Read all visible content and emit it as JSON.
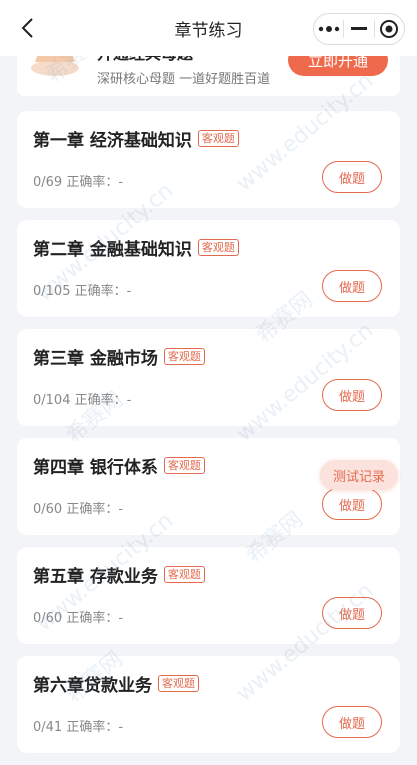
{
  "nav": {
    "title": "章节练习"
  },
  "banner": {
    "title": "开通经典母题",
    "subtitle": "深研核心母题 一道好题胜百道",
    "cta_label": "立即开通"
  },
  "chapters": [
    {
      "title": "第一章 经济基础知识",
      "tag": "客观题",
      "progress": "0/69",
      "accuracy": "正确率：-",
      "action": "做题"
    },
    {
      "title": "第二章 金融基础知识",
      "tag": "客观题",
      "progress": "0/105",
      "accuracy": "正确率：-",
      "action": "做题"
    },
    {
      "title": "第三章 金融市场",
      "tag": "客观题",
      "progress": "0/104",
      "accuracy": "正确率：-",
      "action": "做题"
    },
    {
      "title": "第四章 银行体系",
      "tag": "客观题",
      "progress": "0/60",
      "accuracy": "正确率：-",
      "action": "做题"
    },
    {
      "title": "第五章 存款业务",
      "tag": "客观题",
      "progress": "0/60",
      "accuracy": "正确率：-",
      "action": "做题"
    },
    {
      "title": "第六章贷款业务",
      "tag": "客观题",
      "progress": "0/41",
      "accuracy": "正确率：-",
      "action": "做题"
    }
  ],
  "floating": {
    "record_label": "测试记录"
  },
  "watermark": {
    "text": "www.educity.cn",
    "brand": "希赛网"
  },
  "colors": {
    "accent": "#e36a4f",
    "cta": "#ef6a4c"
  },
  "icons": {
    "back": "chevron-left-icon",
    "more": "more-dots-icon",
    "minimize": "minimize-icon",
    "close": "target-close-icon"
  }
}
